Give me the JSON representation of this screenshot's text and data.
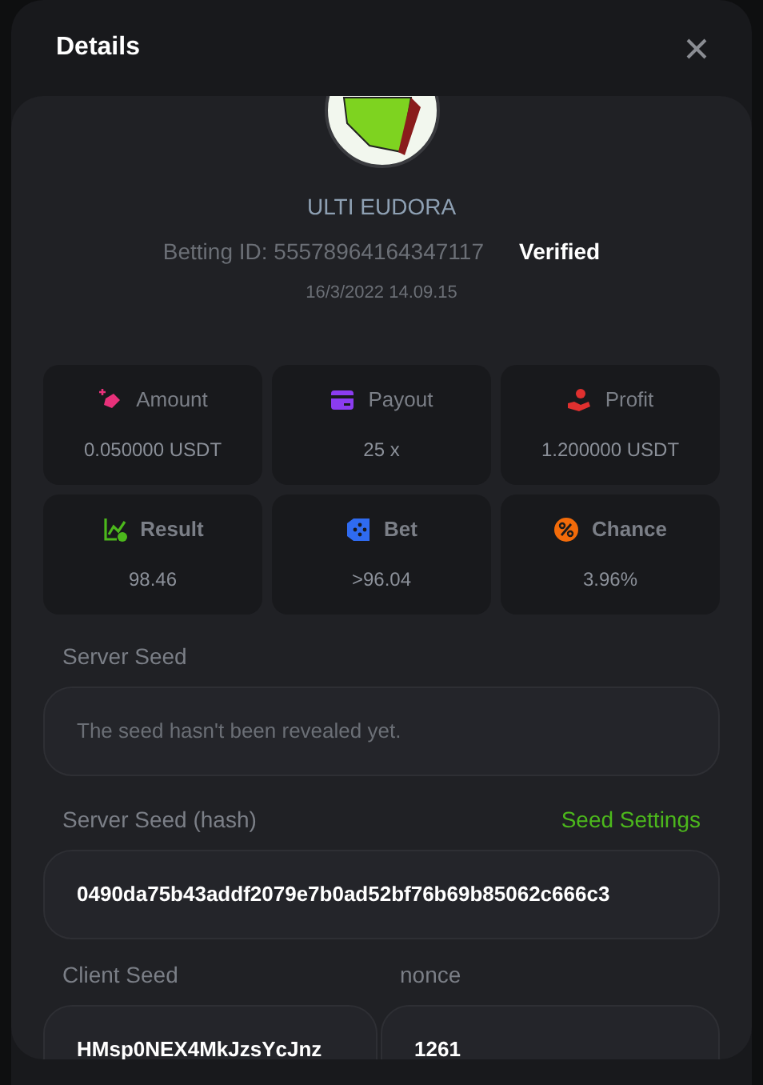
{
  "dialog": {
    "title": "Details"
  },
  "player": {
    "name": "ULTI EUDORA",
    "betting_id": "Betting ID: 55578964164347117",
    "verified": "Verified",
    "date": "16/3/2022 14.09.15"
  },
  "stats": [
    {
      "kind": "amount",
      "label": "Amount",
      "value": "0.050000 USDT",
      "color": "#e8317a",
      "bold": false
    },
    {
      "kind": "payout",
      "label": "Payout",
      "value": "25 x",
      "color": "#8b3cf0",
      "bold": false
    },
    {
      "kind": "profit",
      "label": "Profit",
      "value": "1.200000 USDT",
      "color": "#e0302f",
      "bold": false
    },
    {
      "kind": "result",
      "label": "Result",
      "value": "98.46",
      "color": "#4cb81c",
      "bold": true
    },
    {
      "kind": "bet",
      "label": "Bet",
      "value": ">96.04",
      "color": "#2f6bf0",
      "bold": true
    },
    {
      "kind": "chance",
      "label": "Chance",
      "value": "3.96%",
      "color": "#f26b0a",
      "bold": true
    }
  ],
  "server_seed": {
    "label": "Server Seed",
    "placeholder": "The seed hasn't been revealed yet."
  },
  "server_seed_hash": {
    "label": "Server Seed (hash)",
    "link": "Seed Settings",
    "value": "0490da75b43addf2079e7b0ad52bf76b69b85062c666c3"
  },
  "client_seed": {
    "label": "Client Seed",
    "value": "HMsp0NEX4MkJzsYcJnz"
  },
  "nonce": {
    "label": "nonce",
    "value": "1261"
  }
}
